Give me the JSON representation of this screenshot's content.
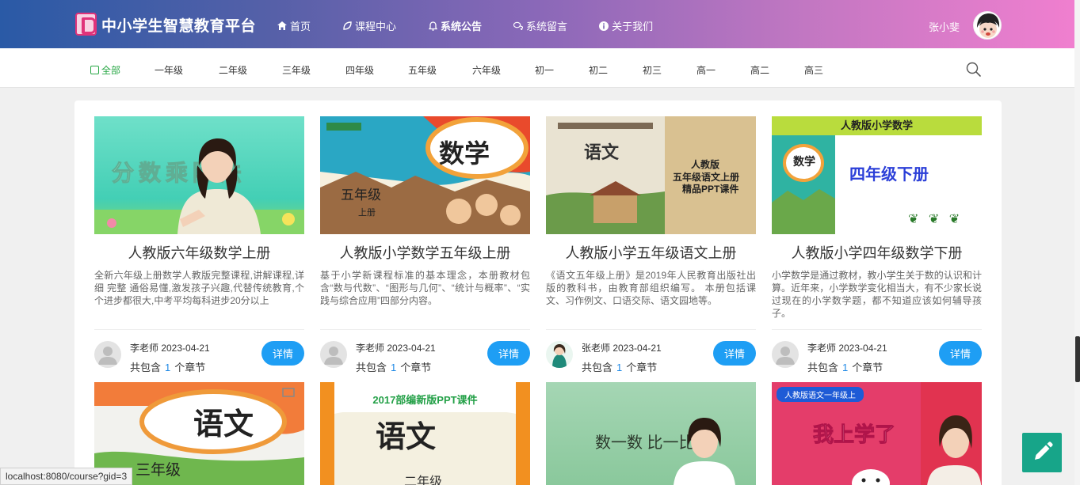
{
  "header": {
    "brand": "中小学生智慧教育平台",
    "nav": [
      {
        "label": "首页",
        "icon": "home-icon"
      },
      {
        "label": "课程中心",
        "icon": "leaf-icon"
      },
      {
        "label": "系统公告",
        "icon": "bell-icon"
      },
      {
        "label": "系统留言",
        "icon": "comments-icon"
      },
      {
        "label": "关于我们",
        "icon": "info-icon"
      }
    ],
    "username": "张小斐"
  },
  "filters": [
    "全部",
    "一年级",
    "二年级",
    "三年级",
    "四年级",
    "五年级",
    "六年级",
    "初一",
    "初二",
    "初三",
    "高一",
    "高二",
    "高三"
  ],
  "courses": [
    {
      "title": "人教版六年级数学上册",
      "desc": "全新六年级上册数学人教版完整课程,讲解课程,详细 完整 通俗易懂,激发孩子兴趣,代替传统教育,个个进步都很大,中考平均每科进步20分以上",
      "author": "李老师 2023-04-21",
      "chapters_prefix": "共包含",
      "chapters": "1",
      "chapters_suffix": "个章节",
      "button": "详情",
      "thumb_text": "分数乘除法"
    },
    {
      "title": "人教版小学数学五年级上册",
      "desc": "基于小学新课程标准的基本理念，本册教材包含“数与代数”、“图形与几何”、“统计与概率”、“实践与综合应用”四部分内容。",
      "author": "李老师 2023-04-21",
      "chapters_prefix": "共包含",
      "chapters": "1",
      "chapters_suffix": "个章节",
      "button": "详情",
      "thumb_text": "数学",
      "thumb_sub": "五年级",
      "thumb_sub2": "上册"
    },
    {
      "title": "人教版小学五年级语文上册",
      "desc": "《语文五年级上册》是2019年人民教育出版社出版的教科书，由教育部组织编写。 本册包括课文、习作例文、口语交际、语文园地等。",
      "author": "张老师 2023-04-21",
      "chapters_prefix": "共包含",
      "chapters": "1",
      "chapters_suffix": "个章节",
      "button": "详情",
      "thumb_text": "语文",
      "thumb_line1": "人教版",
      "thumb_line2": "五年级语文上册",
      "thumb_line3": "精品PPT课件"
    },
    {
      "title": "人教版小学四年级数学下册",
      "desc": "小学数学是通过教材，教小学生关于数的认识和计算。近年来，小学数学变化相当大，有不少家长说过现在的小学数学题，都不知道应该如何辅导孩子。",
      "author": "李老师 2023-04-21",
      "chapters_prefix": "共包含",
      "chapters": "1",
      "chapters_suffix": "个章节",
      "button": "详情",
      "thumb_top": "人教版小学数学",
      "thumb_text": "四年级下册",
      "thumb_badge": "数学"
    }
  ],
  "second_row": [
    {
      "thumb_text": "语文",
      "thumb_sub": "三年级"
    },
    {
      "thumb_top": "2017部编新版PPT课件",
      "thumb_text": "语文",
      "thumb_sub": "二年级"
    },
    {
      "thumb_text": "数一数 比一比"
    },
    {
      "thumb_top": "人教版语文一年级上",
      "thumb_text": "我上学了"
    }
  ],
  "status_url": "localhost:8080/course?gid=3",
  "colors": {
    "accent": "#1e9ef4",
    "active_filter": "#28a745",
    "float_button": "#17a589"
  }
}
